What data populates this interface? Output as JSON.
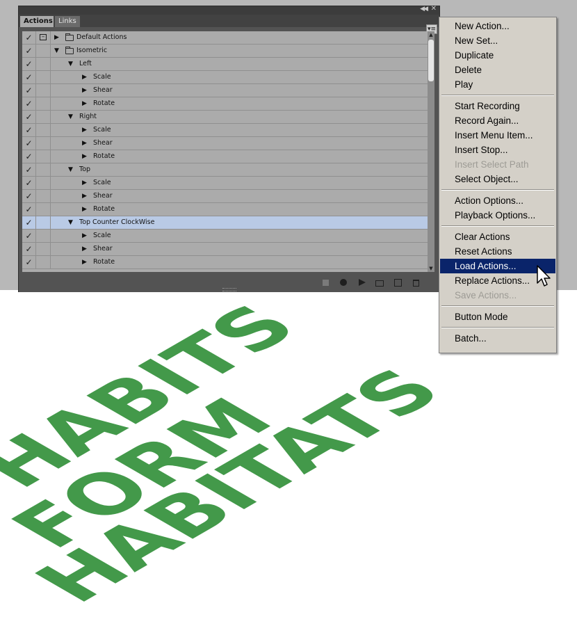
{
  "panel": {
    "tabs": [
      "Actions",
      "Links"
    ],
    "rows": [
      {
        "label": "Default Actions",
        "level": 0,
        "expanded": false,
        "folder": true,
        "dialog": true
      },
      {
        "label": "Isometric",
        "level": 0,
        "expanded": true,
        "folder": true,
        "dialog": false
      },
      {
        "label": "Left",
        "level": 1,
        "expanded": true,
        "folder": false,
        "dialog": false
      },
      {
        "label": "Scale",
        "level": 2,
        "expanded": false,
        "folder": false,
        "dialog": false
      },
      {
        "label": "Shear",
        "level": 2,
        "expanded": false,
        "folder": false,
        "dialog": false
      },
      {
        "label": "Rotate",
        "level": 2,
        "expanded": false,
        "folder": false,
        "dialog": false
      },
      {
        "label": "Right",
        "level": 1,
        "expanded": true,
        "folder": false,
        "dialog": false
      },
      {
        "label": "Scale",
        "level": 2,
        "expanded": false,
        "folder": false,
        "dialog": false
      },
      {
        "label": "Shear",
        "level": 2,
        "expanded": false,
        "folder": false,
        "dialog": false
      },
      {
        "label": "Rotate",
        "level": 2,
        "expanded": false,
        "folder": false,
        "dialog": false
      },
      {
        "label": "Top",
        "level": 1,
        "expanded": true,
        "folder": false,
        "dialog": false
      },
      {
        "label": "Scale",
        "level": 2,
        "expanded": false,
        "folder": false,
        "dialog": false
      },
      {
        "label": "Shear",
        "level": 2,
        "expanded": false,
        "folder": false,
        "dialog": false
      },
      {
        "label": "Rotate",
        "level": 2,
        "expanded": false,
        "folder": false,
        "dialog": false
      },
      {
        "label": "Top Counter ClockWise",
        "level": 1,
        "expanded": true,
        "folder": false,
        "dialog": false,
        "selected": true
      },
      {
        "label": "Scale",
        "level": 2,
        "expanded": false,
        "folder": false,
        "dialog": false
      },
      {
        "label": "Shear",
        "level": 2,
        "expanded": false,
        "folder": false,
        "dialog": false
      },
      {
        "label": "Rotate",
        "level": 2,
        "expanded": false,
        "folder": false,
        "dialog": false
      }
    ],
    "check_glyph": "✓",
    "toolbar_icons": [
      "stop-icon",
      "record-icon",
      "play-icon",
      "new-set-icon",
      "new-action-icon",
      "delete-icon"
    ]
  },
  "menu": {
    "groups": [
      [
        {
          "label": "New Action...",
          "enabled": true
        },
        {
          "label": "New Set...",
          "enabled": true
        },
        {
          "label": "Duplicate",
          "enabled": true
        },
        {
          "label": "Delete",
          "enabled": true
        },
        {
          "label": "Play",
          "enabled": true
        }
      ],
      [
        {
          "label": "Start Recording",
          "enabled": true
        },
        {
          "label": "Record Again...",
          "enabled": true
        },
        {
          "label": "Insert Menu Item...",
          "enabled": true
        },
        {
          "label": "Insert Stop...",
          "enabled": true
        },
        {
          "label": "Insert Select Path",
          "enabled": false
        },
        {
          "label": "Select Object...",
          "enabled": true
        }
      ],
      [
        {
          "label": "Action Options...",
          "enabled": true
        },
        {
          "label": "Playback Options...",
          "enabled": true
        }
      ],
      [
        {
          "label": "Clear Actions",
          "enabled": true
        },
        {
          "label": "Reset Actions",
          "enabled": true
        },
        {
          "label": "Load Actions...",
          "enabled": true,
          "highlighted": true
        },
        {
          "label": "Replace Actions...",
          "enabled": true
        },
        {
          "label": "Save Actions...",
          "enabled": false
        }
      ],
      [
        {
          "label": "Button Mode",
          "enabled": true
        }
      ],
      [
        {
          "label": "Batch...",
          "enabled": true
        }
      ]
    ]
  },
  "artwork": {
    "lines": [
      "HABITS",
      "FORM",
      "HABITATS"
    ],
    "color": "#43994a"
  },
  "colors": {
    "menu_highlight": "#0a246a",
    "selected_row": "#b9cae5"
  }
}
